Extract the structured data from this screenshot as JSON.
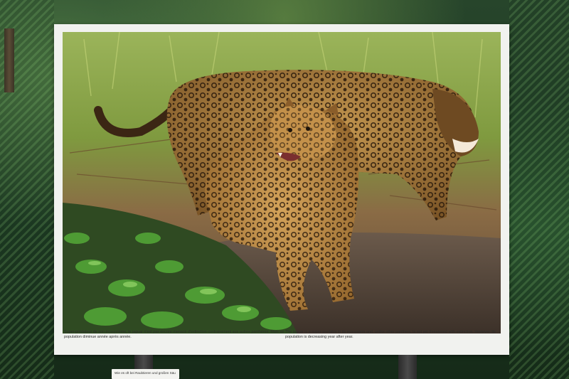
{
  "board": {
    "caption_fr": "Super-prédateur de son écosystème, le jaguar n'est pas encore menacé d'extinction contrairement aux autres panthères. Mais sa population diminue année après année.",
    "caption_en": "The jaguar is a super-predator in its ecosystem and, unlike other panthers, is not yet threatened with extinction. However, its population is decreasing year after year."
  },
  "small_sign": {
    "text": "Wie es oft bei Raubtieren und großen Säu"
  },
  "colors": {
    "board": "#f1f2ef",
    "foliage": "#27452b",
    "jaguar_coat": "#b8863d",
    "vegetation": "#3f8a2c"
  }
}
